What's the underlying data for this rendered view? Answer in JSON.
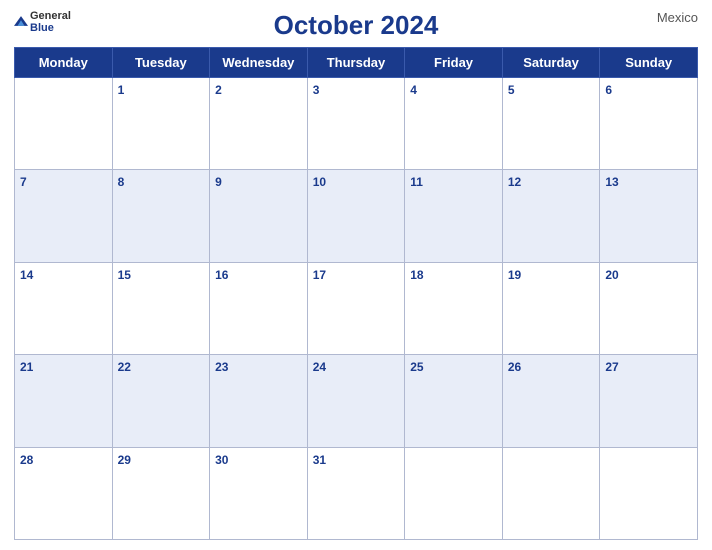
{
  "header": {
    "title": "October 2024",
    "country": "Mexico",
    "logo_general": "General",
    "logo_blue": "Blue"
  },
  "weekdays": [
    "Monday",
    "Tuesday",
    "Wednesday",
    "Thursday",
    "Friday",
    "Saturday",
    "Sunday"
  ],
  "weeks": [
    [
      {
        "day": "",
        "empty": true
      },
      {
        "day": "1"
      },
      {
        "day": "2"
      },
      {
        "day": "3"
      },
      {
        "day": "4"
      },
      {
        "day": "5"
      },
      {
        "day": "6"
      }
    ],
    [
      {
        "day": "7"
      },
      {
        "day": "8"
      },
      {
        "day": "9"
      },
      {
        "day": "10"
      },
      {
        "day": "11"
      },
      {
        "day": "12"
      },
      {
        "day": "13"
      }
    ],
    [
      {
        "day": "14"
      },
      {
        "day": "15"
      },
      {
        "day": "16"
      },
      {
        "day": "17"
      },
      {
        "day": "18"
      },
      {
        "day": "19"
      },
      {
        "day": "20"
      }
    ],
    [
      {
        "day": "21"
      },
      {
        "day": "22"
      },
      {
        "day": "23"
      },
      {
        "day": "24"
      },
      {
        "day": "25"
      },
      {
        "day": "26"
      },
      {
        "day": "27"
      }
    ],
    [
      {
        "day": "28"
      },
      {
        "day": "29"
      },
      {
        "day": "30"
      },
      {
        "day": "31"
      },
      {
        "day": "",
        "empty": true
      },
      {
        "day": "",
        "empty": true
      },
      {
        "day": "",
        "empty": true
      }
    ]
  ]
}
